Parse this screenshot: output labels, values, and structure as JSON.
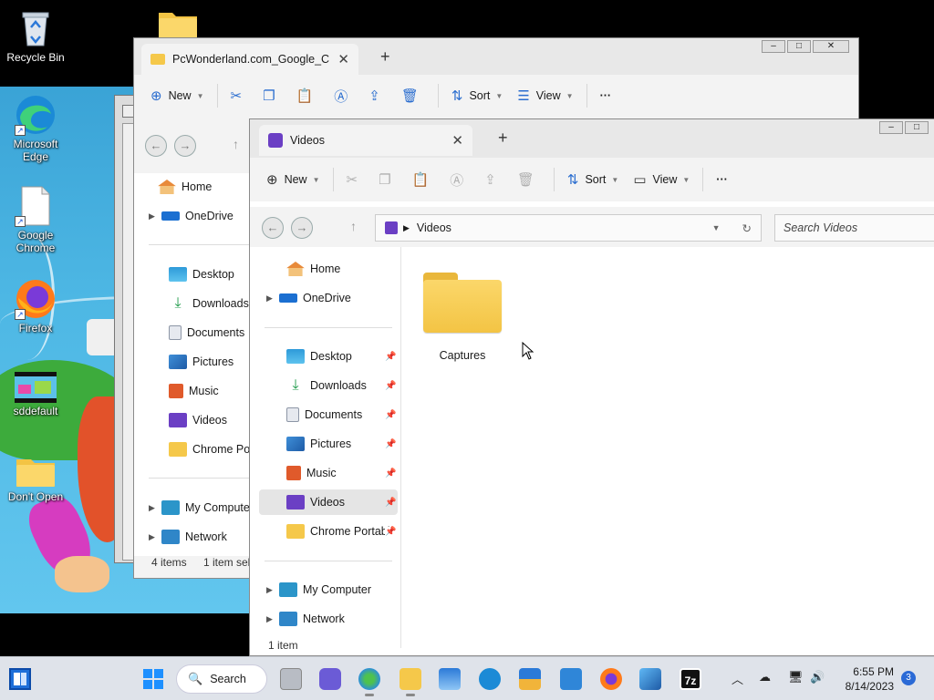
{
  "desktop": {
    "icons": [
      {
        "label": "Recycle Bin"
      },
      {
        "label": "Microsoft Edge"
      },
      {
        "label": "Google Chrome"
      },
      {
        "label": "Firefox"
      },
      {
        "label": "sddefault"
      },
      {
        "label": "Don't Open"
      }
    ]
  },
  "back_window": {
    "tab_title": "PcWonderland.com_Google_C",
    "toolbar": {
      "new": "New",
      "sort": "Sort",
      "view": "View",
      "more": "···"
    },
    "sidebar": {
      "home": "Home",
      "onedrive": "OneDrive",
      "desktop": "Desktop",
      "downloads": "Downloads",
      "documents": "Documents",
      "pictures": "Pictures",
      "music": "Music",
      "videos": "Videos",
      "chrome_portable": "Chrome Port",
      "my_computer": "My Compute",
      "network": "Network"
    },
    "status": {
      "items": "4 items",
      "selected": "1 item sele"
    }
  },
  "front_window": {
    "tab_title": "Videos",
    "toolbar": {
      "new": "New",
      "sort": "Sort",
      "view": "View",
      "more": "···"
    },
    "address": {
      "path": "Videos",
      "search_placeholder": "Search Videos"
    },
    "sidebar": {
      "home": "Home",
      "onedrive": "OneDrive",
      "desktop": "Desktop",
      "downloads": "Downloads",
      "documents": "Documents",
      "pictures": "Pictures",
      "music": "Music",
      "videos": "Videos",
      "chrome_portable": "Chrome Portabl",
      "my_computer": "My Computer",
      "network": "Network"
    },
    "content": [
      {
        "name": "Captures",
        "type": "folder"
      }
    ],
    "status": {
      "items": "1 item"
    }
  },
  "taskbar": {
    "search_label": "Search",
    "clock": {
      "time": "6:55 PM",
      "date": "8/14/2023"
    },
    "notification_count": "3"
  },
  "colors": {
    "accent": "#2a6dcf",
    "folder": "#f5c84a",
    "videos": "#6b3fc4",
    "selection": "#e5e5e5"
  }
}
